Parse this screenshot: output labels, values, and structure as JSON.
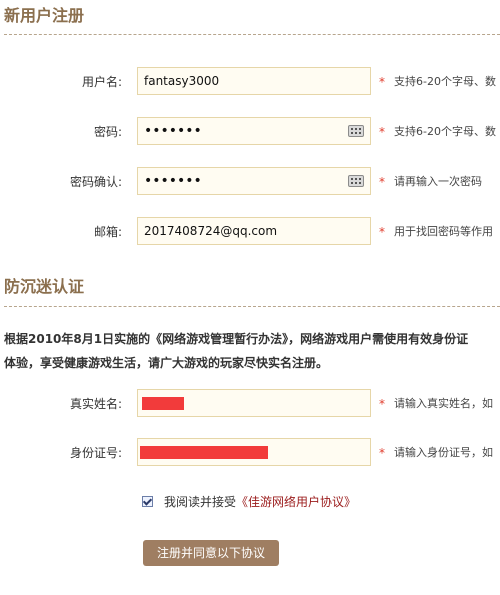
{
  "register": {
    "title": "新用户注册",
    "fields": [
      {
        "label": "用户名:",
        "value": "fantasy3000",
        "hint": "支持6-20个字母、数"
      },
      {
        "label": "密码:",
        "value": "•••••••",
        "hint": "支持6-20个字母、数"
      },
      {
        "label": "密码确认:",
        "value": "•••••••",
        "hint": "请再输入一次密码"
      },
      {
        "label": "邮箱:",
        "value": "2017408724@qq.com",
        "hint": "用于找回密码等作用"
      }
    ],
    "required_mark": "*"
  },
  "verify": {
    "title": "防沉迷认证",
    "notice_line1": "根据2010年8月1日实施的《网络游戏管理暂行办法》，网络游戏用户需使用有效身份证",
    "notice_line2": "体验，享受健康游戏生活，请广大游戏的玩家尽快实名注册。",
    "fields": [
      {
        "label": "真实姓名:",
        "hint": "请输入真实姓名，如"
      },
      {
        "label": "身份证号:",
        "hint": "请输入身份证号，如"
      }
    ]
  },
  "agreement": {
    "prefix": "我阅读并接受",
    "link": "《佳游网络用户协议》",
    "checked": true
  },
  "submit_label": "注册并同意以下协议",
  "icons": {
    "keyboard": "keyboard-icon"
  },
  "colors": {
    "title": "#8b6f4e",
    "button": "#9f7e62",
    "required": "#e03c2c",
    "redaction": "#f23b3b",
    "link": "#9b1c1c"
  }
}
